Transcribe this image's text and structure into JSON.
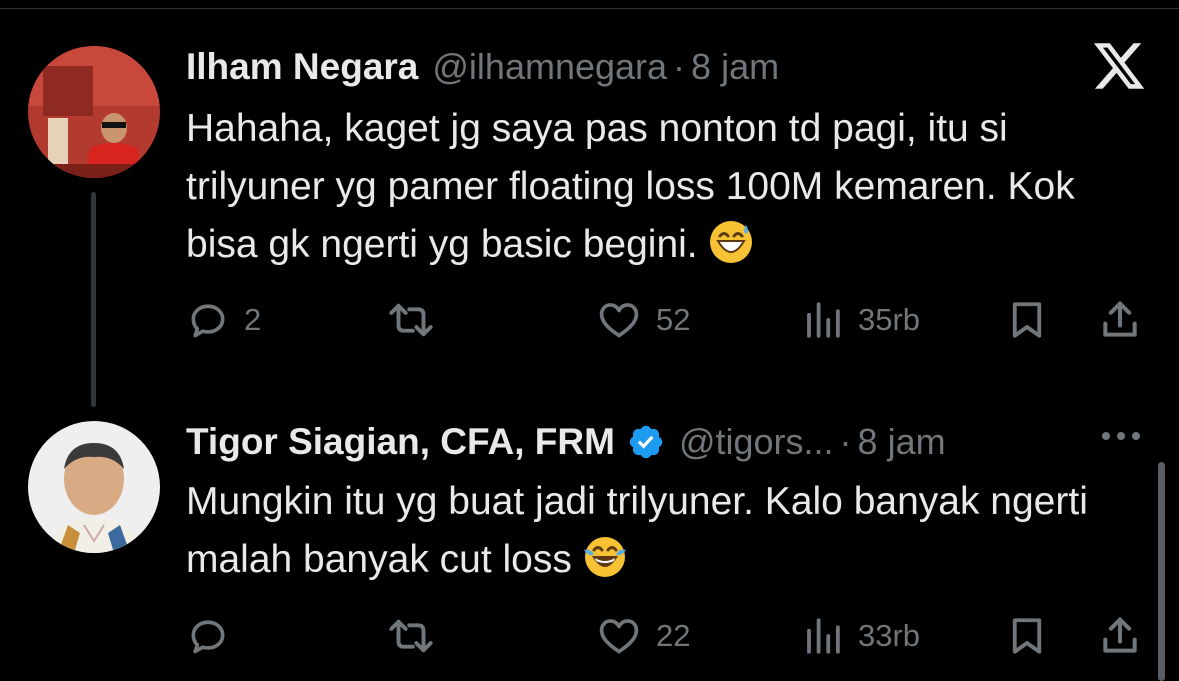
{
  "tweets": [
    {
      "author_name": "Ilham Negara",
      "handle": "@ilhamnegara",
      "separator": "·",
      "time": "8 jam",
      "text": "Hahaha, kaget jg saya pas nonton td pagi, itu si trilyuner yg pamer floating loss 100M kemaren. Kok bisa gk ngerti yg basic begini.",
      "emoji": "grinning-face-with-sweat",
      "verified": false,
      "replies": "2",
      "retweets": "",
      "likes": "52",
      "views": "35rb"
    },
    {
      "author_name": "Tigor Siagian, CFA, FRM",
      "handle": "@tigors...",
      "separator": "·",
      "time": "8 jam",
      "text": "Mungkin itu yg buat jadi trilyuner. Kalo banyak ngerti malah banyak cut loss",
      "emoji": "face-with-tears-of-joy",
      "verified": true,
      "replies": "",
      "retweets": "",
      "likes": "22",
      "views": "33rb"
    }
  ],
  "icons": {
    "reply": "speech-bubble-icon",
    "retweet": "retweet-icon",
    "like": "heart-icon",
    "views": "bar-chart-icon",
    "bookmark": "bookmark-icon",
    "share": "share-icon",
    "brand": "x-logo-icon",
    "more": "more-dots-icon"
  },
  "colors": {
    "background": "#000000",
    "text": "#e7e9ea",
    "secondary": "#71767b",
    "verified": "#1d9bf0"
  }
}
